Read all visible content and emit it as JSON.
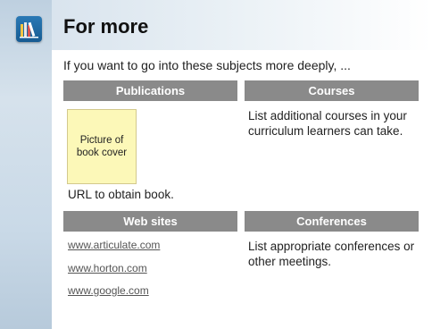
{
  "page": {
    "title": "For more",
    "intro": "If you want to go into these subjects more deeply, ..."
  },
  "sidebar": {
    "icon": "library-books-icon"
  },
  "sections": {
    "publications": {
      "header": "Publications",
      "placeholder_text": "Picture of\nbook cover",
      "caption": "URL to obtain book."
    },
    "courses": {
      "header": "Courses",
      "text": "List additional courses in your curriculum learners can take."
    },
    "web_sites": {
      "header": "Web sites",
      "links": [
        "www.articulate.com",
        "www.horton.com",
        "www.google.com"
      ]
    },
    "conferences": {
      "header": "Conferences",
      "text": "List appropriate conferences or other meetings."
    }
  },
  "colors": {
    "section_header_bg": "#8a8a8a",
    "book_placeholder_bg": "#fcf8b8",
    "logo_bg": "#1f6aa5"
  }
}
